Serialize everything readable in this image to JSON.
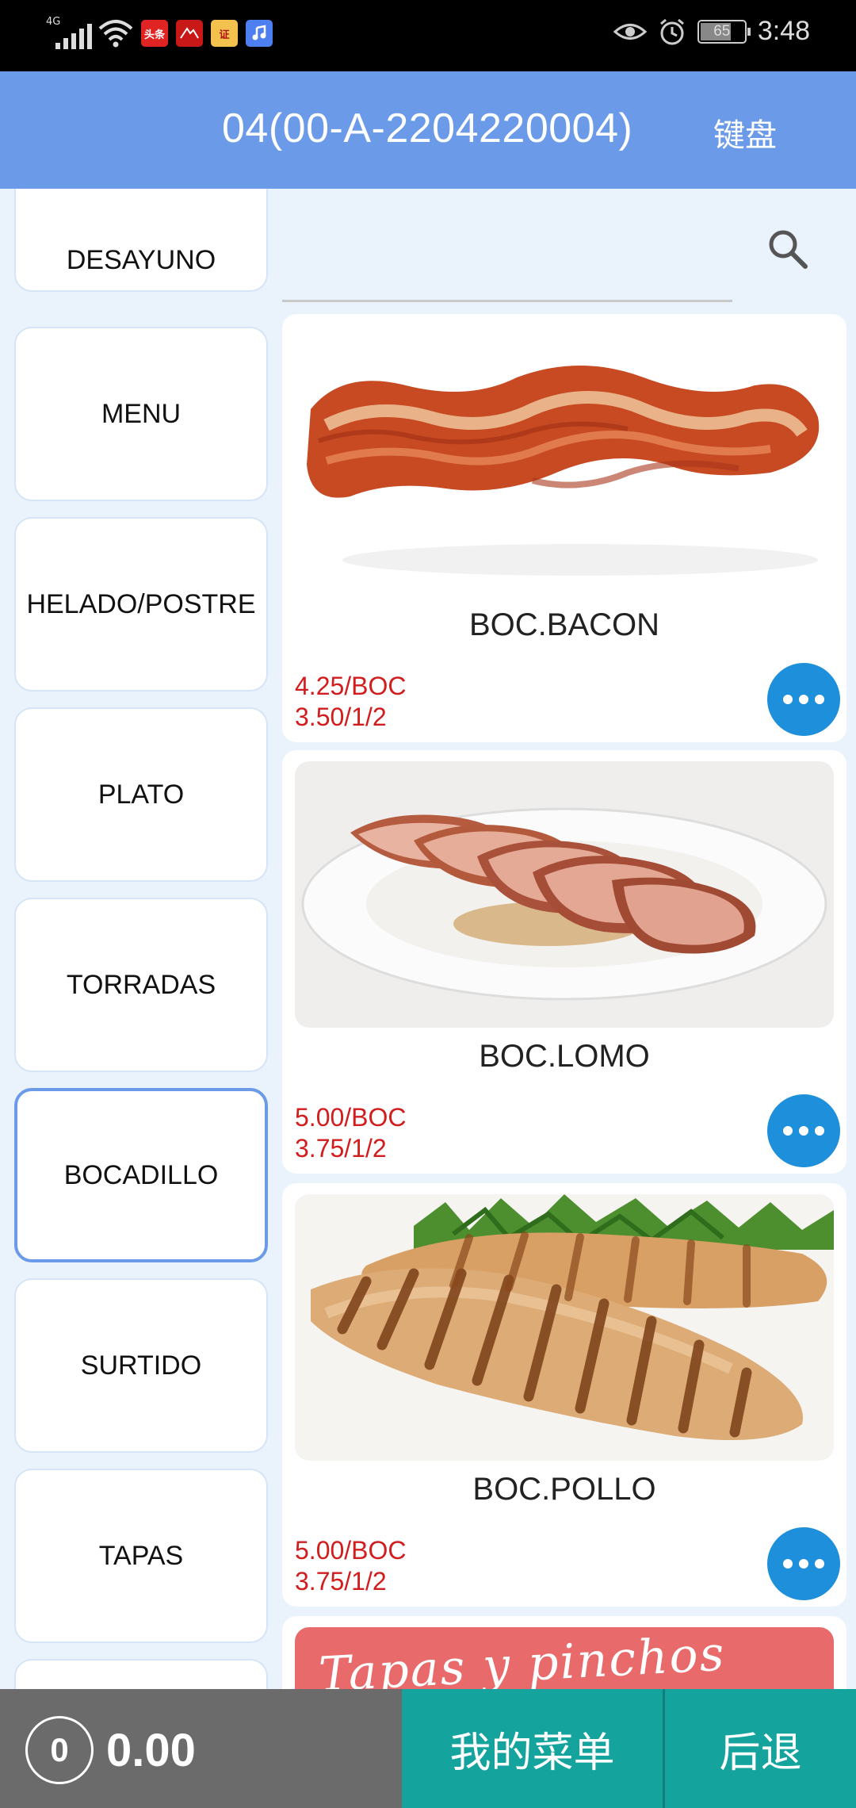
{
  "status_bar": {
    "network": "4G",
    "app_icons": [
      "头条",
      "bank-app",
      "证",
      "music-app"
    ],
    "battery": "65",
    "time": "3:48"
  },
  "header": {
    "title": "04(00-A-2204220004)",
    "keyboard_label": "键盘"
  },
  "categories": [
    {
      "label": "DESAYUNO",
      "active": false
    },
    {
      "label": "MENU",
      "active": false
    },
    {
      "label": "HELADO/POSTRE",
      "active": false
    },
    {
      "label": "PLATO",
      "active": false
    },
    {
      "label": "TORRADAS",
      "active": false
    },
    {
      "label": "BOCADILLO",
      "active": true
    },
    {
      "label": "SURTIDO",
      "active": false
    },
    {
      "label": "TAPAS",
      "active": false
    }
  ],
  "search": {
    "icon": "search-icon"
  },
  "products": [
    {
      "name": "BOC.BACON",
      "price_1": "4.25/BOC",
      "price_2": "3.50/1/2",
      "image": "bacon"
    },
    {
      "name": "BOC.LOMO",
      "price_1": "5.00/BOC",
      "price_2": "3.75/1/2",
      "image": "lomo"
    },
    {
      "name": "BOC.POLLO",
      "price_1": "5.00/BOC",
      "price_2": "3.75/1/2",
      "image": "pollo"
    },
    {
      "name": "",
      "image": "tapas-banner",
      "banner_text": "Tapas y pinchos"
    }
  ],
  "bottom_bar": {
    "count": "0",
    "total": "0.00",
    "my_menu_label": "我的菜单",
    "back_label": "后退"
  },
  "colors": {
    "header_blue": "#6b9be8",
    "price_red": "#d11d1d",
    "more_button_blue": "#1e8fdb",
    "teal": "#14a39d",
    "gray": "#6b6b6b"
  }
}
